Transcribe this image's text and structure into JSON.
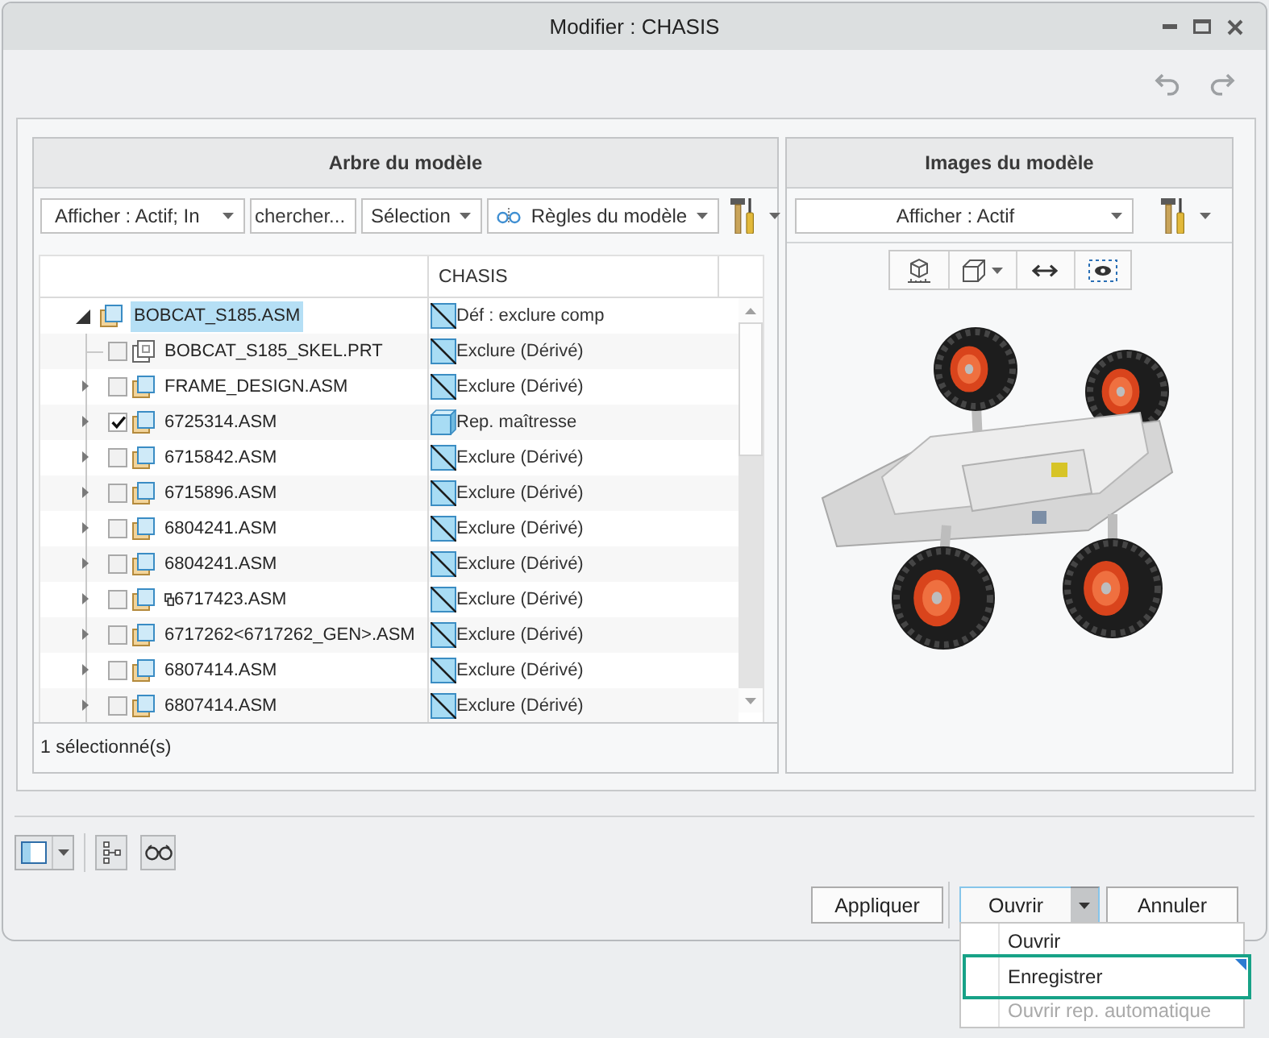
{
  "window": {
    "title": "Modifier : CHASIS"
  },
  "model_tree": {
    "title": "Arbre du modèle",
    "toolbar": {
      "display_filter": "Afficher : Actif; In",
      "search": {
        "placeholder": "chercher..."
      },
      "selection_filter": "Sélection",
      "rules": "Règles du modèle"
    },
    "column_header": "CHASIS",
    "root": {
      "name": "BOBCAT_S185.ASM",
      "kind": "assembly",
      "expanded": true,
      "selected": true,
      "status": {
        "kind": "exclude",
        "text": "Déf : exclure comp"
      },
      "children": [
        {
          "name": "BOBCAT_S185_SKEL.PRT",
          "kind": "skeleton",
          "expandable": false,
          "checked": false,
          "selected": false,
          "overlay_icon": false,
          "status": {
            "kind": "exclude",
            "text": "Exclure (Dérivé)"
          }
        },
        {
          "name": "FRAME_DESIGN.ASM",
          "kind": "assembly",
          "expandable": true,
          "checked": false,
          "selected": false,
          "overlay_icon": false,
          "status": {
            "kind": "exclude",
            "text": "Exclure (Dérivé)"
          }
        },
        {
          "name": "6725314.ASM",
          "kind": "assembly",
          "expandable": true,
          "checked": true,
          "selected": false,
          "overlay_icon": false,
          "status": {
            "kind": "master",
            "text": "Rep. maîtresse"
          }
        },
        {
          "name": "6715842.ASM",
          "kind": "assembly",
          "expandable": true,
          "checked": false,
          "selected": false,
          "overlay_icon": false,
          "status": {
            "kind": "exclude",
            "text": "Exclure (Dérivé)"
          }
        },
        {
          "name": "6715896.ASM",
          "kind": "assembly",
          "expandable": true,
          "checked": false,
          "selected": false,
          "overlay_icon": false,
          "status": {
            "kind": "exclude",
            "text": "Exclure (Dérivé)"
          }
        },
        {
          "name": "6804241.ASM",
          "kind": "assembly",
          "expandable": true,
          "checked": false,
          "selected": false,
          "overlay_icon": false,
          "status": {
            "kind": "exclude",
            "text": "Exclure (Dérivé)"
          }
        },
        {
          "name": "6804241.ASM",
          "kind": "assembly",
          "expandable": true,
          "checked": false,
          "selected": false,
          "overlay_icon": false,
          "status": {
            "kind": "exclude",
            "text": "Exclure (Dérivé)"
          }
        },
        {
          "name": "6717423.ASM",
          "kind": "assembly",
          "expandable": true,
          "checked": false,
          "selected": false,
          "overlay_icon": true,
          "status": {
            "kind": "exclude",
            "text": "Exclure (Dérivé)"
          }
        },
        {
          "name": "6717262<6717262_GEN>.ASM",
          "kind": "assembly",
          "expandable": true,
          "checked": false,
          "selected": false,
          "overlay_icon": false,
          "status": {
            "kind": "exclude",
            "text": "Exclure (Dérivé)"
          }
        },
        {
          "name": "6807414.ASM",
          "kind": "assembly",
          "expandable": true,
          "checked": false,
          "selected": false,
          "overlay_icon": false,
          "status": {
            "kind": "exclude",
            "text": "Exclure (Dérivé)"
          }
        },
        {
          "name": "6807414.ASM",
          "kind": "assembly",
          "expandable": true,
          "checked": false,
          "selected": false,
          "overlay_icon": false,
          "status": {
            "kind": "exclude",
            "text": "Exclure (Dérivé)"
          }
        }
      ]
    },
    "status_bar": "1 sélectionné(s)"
  },
  "model_images": {
    "title": "Images du modèle",
    "display_filter": "Afficher : Actif"
  },
  "dialog_buttons": [
    {
      "kind": "push",
      "label": "Appliquer"
    },
    {
      "kind": "split",
      "label": "Ouvrir",
      "open": true,
      "menu": [
        {
          "label": "Ouvrir",
          "disabled": false,
          "highlighted": false
        },
        {
          "label": "Enregistrer",
          "disabled": false,
          "highlighted": true
        },
        {
          "label": "Ouvrir rep. automatique",
          "disabled": true,
          "highlighted": false
        }
      ]
    },
    {
      "kind": "push",
      "label": "Annuler"
    }
  ]
}
